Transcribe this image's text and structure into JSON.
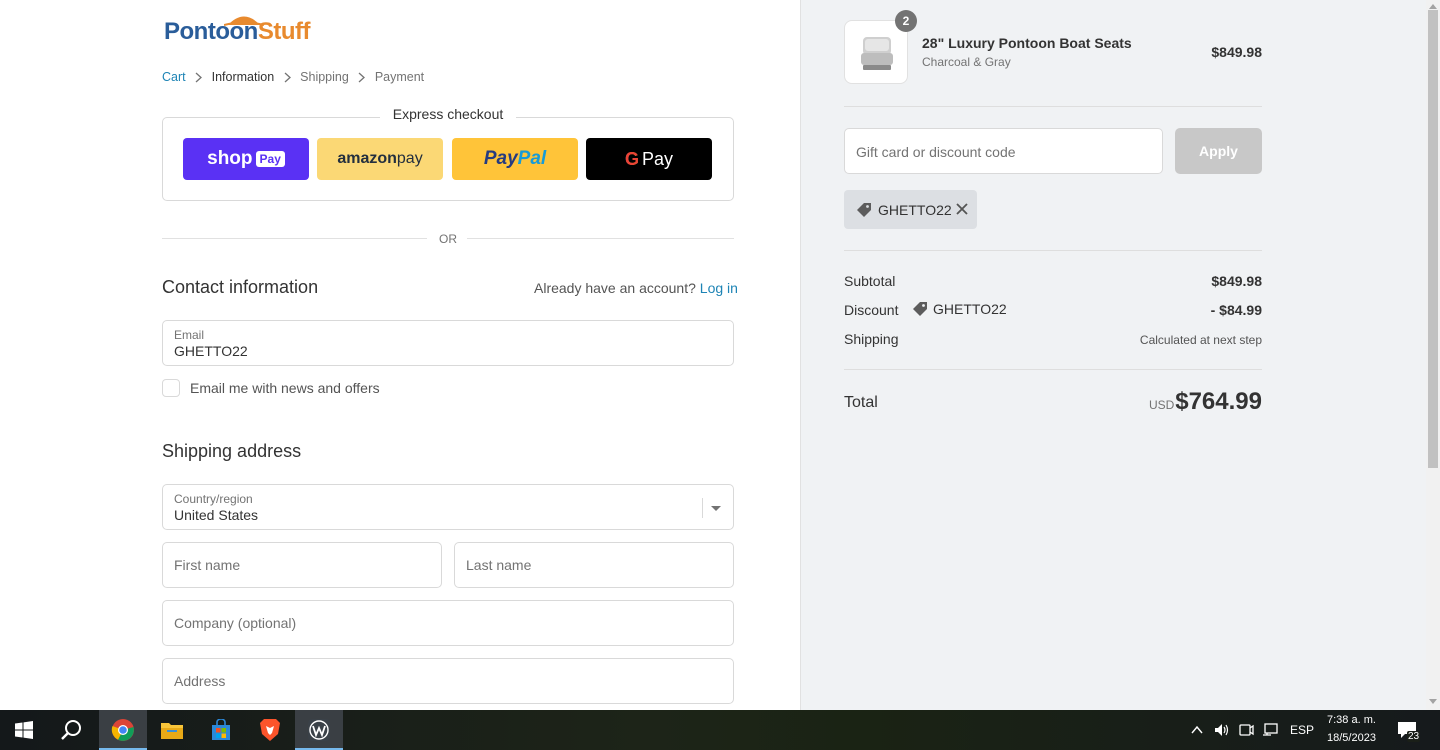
{
  "brand": {
    "logo_primary": "Pontoon",
    "logo_secondary": "Stuff",
    "color_primary": "#2a5d9a",
    "color_secondary": "#e88a2e"
  },
  "breadcrumb": {
    "cart": "Cart",
    "information": "Information",
    "shipping": "Shipping",
    "payment": "Payment"
  },
  "express": {
    "title": "Express checkout",
    "shop_pay": "shop",
    "shop_pay_tag": "Pay",
    "amazon_pay_1": "amazon",
    "amazon_pay_2": " pay",
    "paypal_1": "Pay",
    "paypal_2": "Pal",
    "gpay_g": "G",
    "gpay_label": "Pay"
  },
  "divider": {
    "or": "OR"
  },
  "contact": {
    "heading": "Contact information",
    "account_prompt": "Already have an account?",
    "login_link": "Log in",
    "email_label": "Email",
    "email_value": "GHETTO22",
    "newsletter_label": "Email me with news and offers",
    "newsletter_checked": false
  },
  "shipping": {
    "heading": "Shipping address",
    "country_label": "Country/region",
    "country_value": "United States",
    "first_name_placeholder": "First name",
    "last_name_placeholder": "Last name",
    "company_placeholder": "Company (optional)",
    "address_placeholder": "Address"
  },
  "order": {
    "quantity": "2",
    "product_name": "28\" Luxury Pontoon Boat Seats",
    "product_variant": "Charcoal & Gray",
    "product_price": "$849.98",
    "discount_placeholder": "Gift card or discount code",
    "apply_label": "Apply",
    "applied_code": "GHETTO22",
    "subtotal_label": "Subtotal",
    "subtotal_value": "$849.98",
    "discount_label": "Discount",
    "discount_code": "GHETTO22",
    "discount_value": "- $84.99",
    "shipping_label": "Shipping",
    "shipping_value": "Calculated at next step",
    "total_label": "Total",
    "total_currency": "USD",
    "total_value": "$764.99"
  },
  "taskbar": {
    "apps": [
      "start-icon",
      "search-icon",
      "chrome-icon",
      "file-explorer-icon",
      "store-icon",
      "brave-icon",
      "wordpress-icon"
    ],
    "language": "ESP",
    "time": "7:38 a. m.",
    "date": "18/5/2023",
    "notifications": "23"
  }
}
